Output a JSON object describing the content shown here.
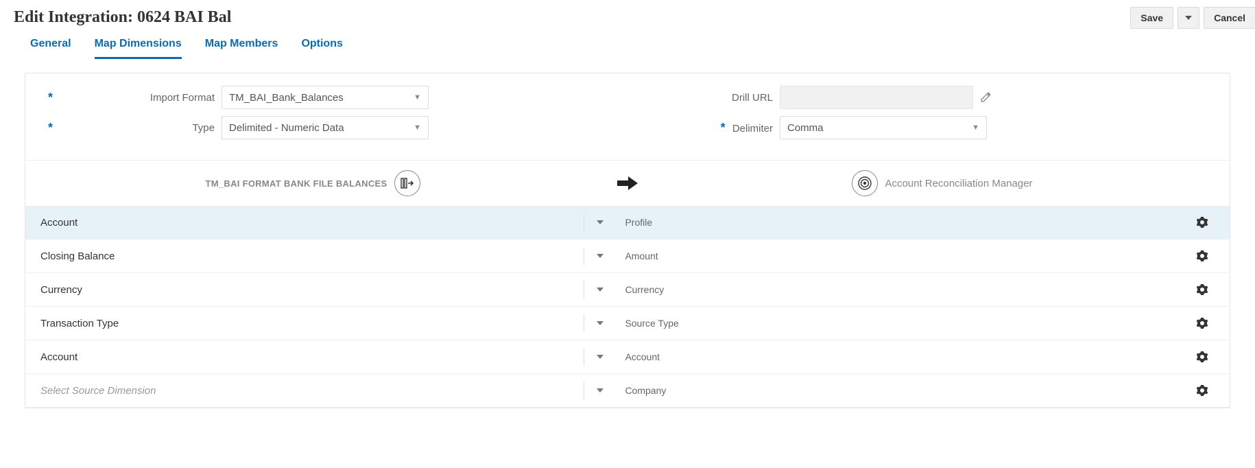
{
  "header": {
    "title": "Edit Integration: 0624 BAI Bal",
    "save_label": "Save",
    "cancel_label": "Cancel"
  },
  "tabs": {
    "general": "General",
    "map_dimensions": "Map Dimensions",
    "map_members": "Map Members",
    "options": "Options",
    "active": "map_dimensions"
  },
  "form": {
    "import_format_label": "Import Format",
    "import_format_value": "TM_BAI_Bank_Balances",
    "type_label": "Type",
    "type_value": "Delimited - Numeric Data",
    "drill_url_label": "Drill URL",
    "drill_url_value": "",
    "delimiter_label": "Delimiter",
    "delimiter_value": "Comma"
  },
  "source_target": {
    "source_label": "TM_BAI FORMAT BANK FILE BALANCES",
    "target_label": "Account Reconciliation Manager"
  },
  "rows": [
    {
      "source": "Account",
      "target": "Profile",
      "selected": true,
      "placeholder": false
    },
    {
      "source": "Closing Balance",
      "target": "Amount",
      "selected": false,
      "placeholder": false
    },
    {
      "source": "Currency",
      "target": "Currency",
      "selected": false,
      "placeholder": false
    },
    {
      "source": "Transaction Type",
      "target": "Source Type",
      "selected": false,
      "placeholder": false
    },
    {
      "source": "Account",
      "target": "Account",
      "selected": false,
      "placeholder": false
    },
    {
      "source": "Select Source Dimension",
      "target": "Company",
      "selected": false,
      "placeholder": true
    }
  ]
}
